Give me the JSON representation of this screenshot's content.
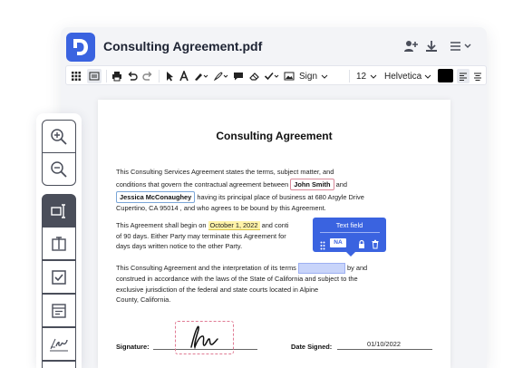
{
  "window": {
    "title": "Consulting Agreement.pdf"
  },
  "toolbar": {
    "sign_label": "Sign",
    "font_size": "12",
    "font_family": "Helvetica",
    "color": "#000000"
  },
  "document": {
    "heading": "Consulting Agreement",
    "para1_a": "This Consulting Services Agreement states the terms, subject matter,  and",
    "para1_b": "conditions that govern the contractual agreement between",
    "party1": "John Smith",
    "para1_c": "and",
    "party2": "Jessica McConaughey",
    "para1_d": "having its principal place of business at 680 Argyle Drive",
    "para1_e": "Cupertino, CA 95014 , and who agrees to be bound by this Agreement.",
    "para2_a": "This Agreement shall begin on",
    "start_date": "October 1, 2022",
    "para2_b": "and conti",
    "para2_c": "of 90 days. Either Party may terminate this Agreement for",
    "para2_d": "days days written notice to the other Party.",
    "para3_a": "This Consulting Agreement and the interpretation of its terms",
    "para3_b": "by and",
    "para3_c": "construed in accordance with the laws of the State of California and subject to the",
    "para3_d": "exclusive jurisdiction of the federal and state courts located in Alpine",
    "para3_e": "County, California.",
    "signature_label": "Signature:",
    "date_signed_label": "Date Signed:",
    "date_signed_value": "01/10/2022"
  },
  "text_field_popup": {
    "title": "Text field",
    "badge": "NA"
  }
}
